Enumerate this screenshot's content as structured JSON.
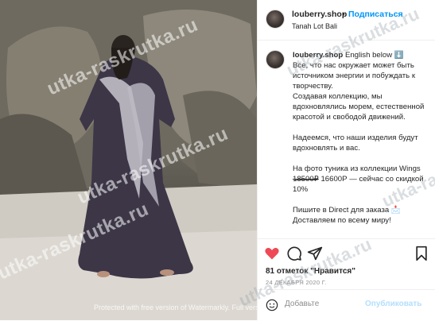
{
  "post": {
    "username": "louberry.shop",
    "separator": "•",
    "follow_label": "Подписаться",
    "location": "Tanah Lot Bali",
    "caption_user": "louberry.shop",
    "caption_first": "English below ⬇️\nВсе, что нас окружает может быть источником энергии и побуждать к творчеству.\nСоздавая коллекцию, мы вдохновлялись морем, естественной красотой и свободой движений.",
    "caption_p2": "Надеемся, что наши изделия будут вдохновлять и вас.",
    "caption_p3": "На фото туника из коллекции Wings",
    "price_old": "1̶8̶5̶0̶0̶₽",
    "price_new": " 16600Р — сейчас со скидкой 10%",
    "caption_p4": "Пишите в Direct для заказа 📩\nДоставляем по всему миру!",
    "likes": "81 отметок \"Нравится\"",
    "date": "24 ДЕКАБРЯ 2020 Г.",
    "comment_placeholder": "Добавьте",
    "publish_label": "Опубликовать",
    "like_color": "#ed4956"
  },
  "watermark": {
    "text": "utka-raskrutka.ru",
    "protected": "Protected with free version of Watermarkly. Full version doesn't put this mark."
  }
}
